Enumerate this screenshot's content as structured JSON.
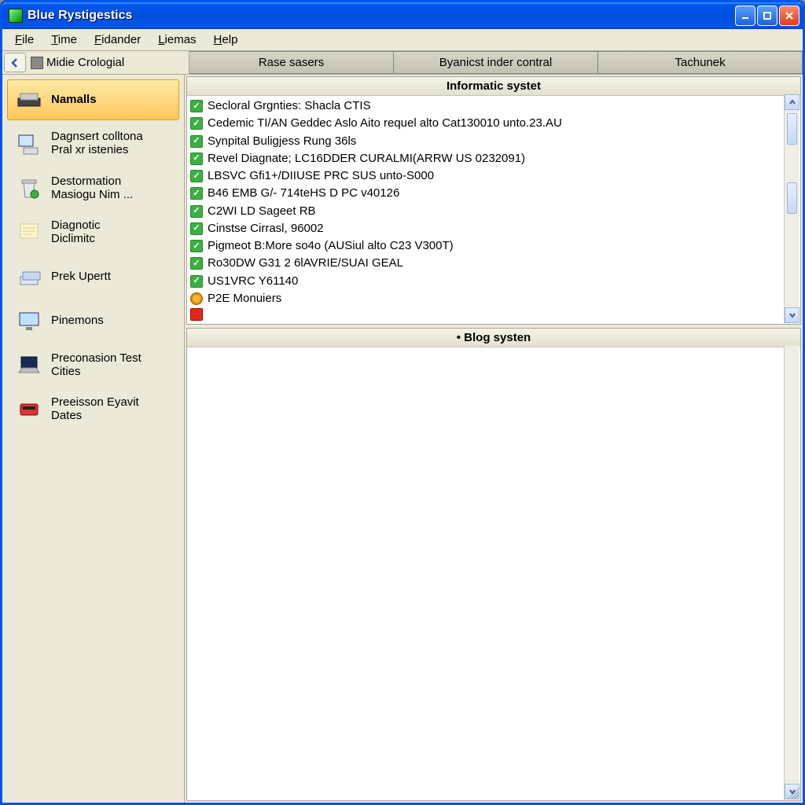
{
  "window": {
    "title": "Blue Rystigestics"
  },
  "menu": {
    "items": [
      {
        "label": "File",
        "accel": "F"
      },
      {
        "label": "Time",
        "accel": "T"
      },
      {
        "label": "Fidander",
        "accel": "F"
      },
      {
        "label": "Liemas",
        "accel": "L"
      },
      {
        "label": "Help",
        "accel": "H"
      }
    ]
  },
  "nav": {
    "crumb": "Midie Crologial",
    "tabs": [
      {
        "label": "Rase sasers"
      },
      {
        "label": "Byanicst inder contral"
      },
      {
        "label": "Tachunek"
      }
    ]
  },
  "sidebar": {
    "items": [
      {
        "label": "Namalls",
        "icon": "scanner",
        "selected": true
      },
      {
        "label": "Dagnsert colltona\nPral xr istenies",
        "icon": "pc",
        "selected": false
      },
      {
        "label": "Destormation\nMasiogu Nim ...",
        "icon": "bin",
        "selected": false
      },
      {
        "label": "Diagnotic\nDiclimitc",
        "icon": "note",
        "selected": false
      },
      {
        "label": "Prek Upertt",
        "icon": "stack",
        "selected": false
      },
      {
        "label": "Pinemons",
        "icon": "monitor",
        "selected": false
      },
      {
        "label": "Preconasion Test\nCities",
        "icon": "laptop",
        "selected": false
      },
      {
        "label": "Preeisson Eyavit\nDates",
        "icon": "device",
        "selected": false
      }
    ]
  },
  "main": {
    "top": {
      "title": "Informatic systet",
      "rows": [
        {
          "status": "ok",
          "text": "Secloral Grgnties: Shacla CTIS"
        },
        {
          "status": "ok",
          "text": "Cedemic TI/AN Geddec Aslo Aito requel alto Cat130010 unto.23.AU"
        },
        {
          "status": "ok",
          "text": "Synpital Buligjess Rung 36ls"
        },
        {
          "status": "ok",
          "text": "Revel Diagnate; LC16DDER CURALMI(ARRW US 0232091)"
        },
        {
          "status": "ok",
          "text": "LBSVC Gfi1+/DIIUSE PRC SUS unto-S000"
        },
        {
          "status": "ok",
          "text": "B46 EMB G/- 714teHS D PC v40126"
        },
        {
          "status": "ok",
          "text": "C2WI LD Sageet RB"
        },
        {
          "status": "ok",
          "text": "Cinstse Cirrasl, 96002"
        },
        {
          "status": "ok",
          "text": "Pigmeot B:More so4o (AUSiul alto C23 V300T)"
        },
        {
          "status": "ok",
          "text": "Ro30DW G31 2 6lAVRIE/SUAI GEAL"
        },
        {
          "status": "ok",
          "text": "US1VRC Y61140"
        },
        {
          "status": "warn",
          "text": "P2E Monuiers"
        },
        {
          "status": "err",
          "text": ""
        }
      ]
    },
    "bottom": {
      "title": "• Blog systen"
    }
  }
}
